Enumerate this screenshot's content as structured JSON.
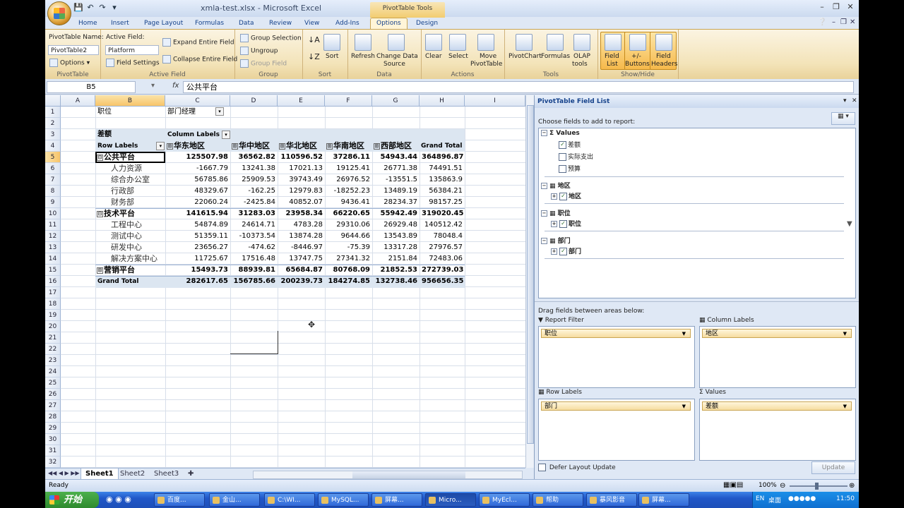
{
  "window": {
    "title": "xmla-test.xlsx - Microsoft Excel",
    "context_tab": "PivotTable Tools"
  },
  "tabs": [
    "Home",
    "Insert",
    "Page Layout",
    "Formulas",
    "Data",
    "Review",
    "View",
    "Add-Ins",
    "Options",
    "Design"
  ],
  "ribbon": {
    "pt_name_label": "PivotTable Name:",
    "pt_name_value": "PivotTable2",
    "options_label": "Options",
    "group_pivottable": "PivotTable",
    "active_field_label": "Active Field:",
    "active_field_value": "Platform",
    "field_settings": "Field Settings",
    "expand_entire": "Expand Entire Field",
    "collapse_entire": "Collapse Entire Field",
    "group_active_field": "Active Field",
    "group_selection": "Group Selection",
    "ungroup": "Ungroup",
    "group_field": "Group Field",
    "group_group": "Group",
    "sort": "Sort",
    "group_sort": "Sort",
    "refresh": "Refresh",
    "change_source_1": "Change Data",
    "change_source_2": "Source",
    "group_data": "Data",
    "clear": "Clear",
    "select": "Select",
    "move_1": "Move",
    "move_2": "PivotTable",
    "group_actions": "Actions",
    "pivotchart": "PivotChart",
    "formulas": "Formulas",
    "olap_1": "OLAP",
    "olap_2": "tools",
    "group_tools": "Tools",
    "field_list_1": "Field",
    "field_list_2": "List",
    "buttons_1": "+/-",
    "buttons_2": "Buttons",
    "headers_1": "Field",
    "headers_2": "Headers",
    "group_showhide": "Show/Hide"
  },
  "formula_bar": {
    "name_box": "B5",
    "fx": "fx",
    "formula": "公共平台"
  },
  "grid": {
    "columns": [
      "A",
      "B",
      "C",
      "D",
      "E",
      "F",
      "G",
      "H",
      "I"
    ],
    "rows": [
      "1",
      "2",
      "3",
      "4",
      "5",
      "6",
      "7",
      "8",
      "9",
      "10",
      "11",
      "12",
      "13",
      "14",
      "15",
      "16",
      "17",
      "18",
      "19",
      "20",
      "21",
      "22",
      "23",
      "24",
      "25",
      "26",
      "27",
      "28",
      "29",
      "30",
      "31",
      "32"
    ]
  },
  "pivot": {
    "filter_label": "职位",
    "filter_value": "部门经理",
    "value_label": "差额",
    "column_labels": "Column Labels",
    "row_labels": "Row Labels",
    "col_headers": [
      "华东地区",
      "华中地区",
      "华北地区",
      "华南地区",
      "西部地区",
      "Grand Total"
    ],
    "rows": [
      {
        "label": "公共平台",
        "level": 0,
        "sign": "⊟",
        "bold": true,
        "values": [
          "125507.98",
          "36562.82",
          "110596.52",
          "37286.11",
          "54943.44",
          "364896.87"
        ]
      },
      {
        "label": "人力资源",
        "level": 1,
        "values": [
          "-1667.79",
          "13241.38",
          "17021.13",
          "19125.41",
          "26771.38",
          "74491.51"
        ]
      },
      {
        "label": "综合办公室",
        "level": 1,
        "values": [
          "56785.86",
          "25909.53",
          "39743.49",
          "26976.52",
          "-13551.5",
          "135863.9"
        ]
      },
      {
        "label": "行政部",
        "level": 1,
        "values": [
          "48329.67",
          "-162.25",
          "12979.83",
          "-18252.23",
          "13489.19",
          "56384.21"
        ]
      },
      {
        "label": "财务部",
        "level": 1,
        "values": [
          "22060.24",
          "-2425.84",
          "40852.07",
          "9436.41",
          "28234.37",
          "98157.25"
        ]
      },
      {
        "label": "技术平台",
        "level": 0,
        "sign": "⊟",
        "bold": true,
        "values": [
          "141615.94",
          "31283.03",
          "23958.34",
          "66220.65",
          "55942.49",
          "319020.45"
        ]
      },
      {
        "label": "工程中心",
        "level": 1,
        "values": [
          "54874.89",
          "24614.71",
          "4783.28",
          "29310.06",
          "26929.48",
          "140512.42"
        ]
      },
      {
        "label": "测试中心",
        "level": 1,
        "values": [
          "51359.11",
          "-10373.54",
          "13874.28",
          "9644.66",
          "13543.89",
          "78048.4"
        ]
      },
      {
        "label": "研发中心",
        "level": 1,
        "values": [
          "23656.27",
          "-474.62",
          "-8446.97",
          "-75.39",
          "13317.28",
          "27976.57"
        ]
      },
      {
        "label": "解决方案中心",
        "level": 1,
        "values": [
          "11725.67",
          "17516.48",
          "13747.75",
          "27341.32",
          "2151.84",
          "72483.06"
        ]
      },
      {
        "label": "营销平台",
        "level": 0,
        "sign": "⊞",
        "bold": true,
        "values": [
          "15493.73",
          "88939.81",
          "65684.87",
          "80768.09",
          "21852.53",
          "272739.03"
        ]
      }
    ],
    "grand_total_label": "Grand Total",
    "grand_total": [
      "282617.65",
      "156785.66",
      "200239.73",
      "184274.85",
      "132738.46",
      "956656.35"
    ]
  },
  "sheets": [
    "Sheet1",
    "Sheet2",
    "Sheet3"
  ],
  "status": {
    "ready": "Ready",
    "zoom": "100%"
  },
  "field_list": {
    "title": "PivotTable Field List",
    "choose": "Choose fields to add to report:",
    "values_group": "Values",
    "values_items": [
      {
        "name": "差额",
        "checked": true
      },
      {
        "name": "实际支出",
        "checked": false
      },
      {
        "name": "预算",
        "checked": false
      }
    ],
    "dims": [
      {
        "name": "地区",
        "child": "地区"
      },
      {
        "name": "职位",
        "child": "职位"
      },
      {
        "name": "部门",
        "child": "部门"
      }
    ],
    "drag_text": "Drag fields between areas below:",
    "report_filter": "Report Filter",
    "column_labels": "Column Labels",
    "row_labels": "Row Labels",
    "values": "Values",
    "report_filter_item": "职位",
    "column_labels_item": "地区",
    "row_labels_item": "部门",
    "values_item": "差额",
    "defer": "Defer Layout Update",
    "update": "Update"
  },
  "taskbar": {
    "start": "开始",
    "items": [
      "百度...",
      "金山...",
      "C:\\WI...",
      "MySQL...",
      "屏幕...",
      "Micro...",
      "MyEcl...",
      "帮助",
      "暴风影音",
      "屏幕..."
    ],
    "tray_lang": "EN",
    "tray_desktop": "桌面",
    "clock": "11:50"
  }
}
